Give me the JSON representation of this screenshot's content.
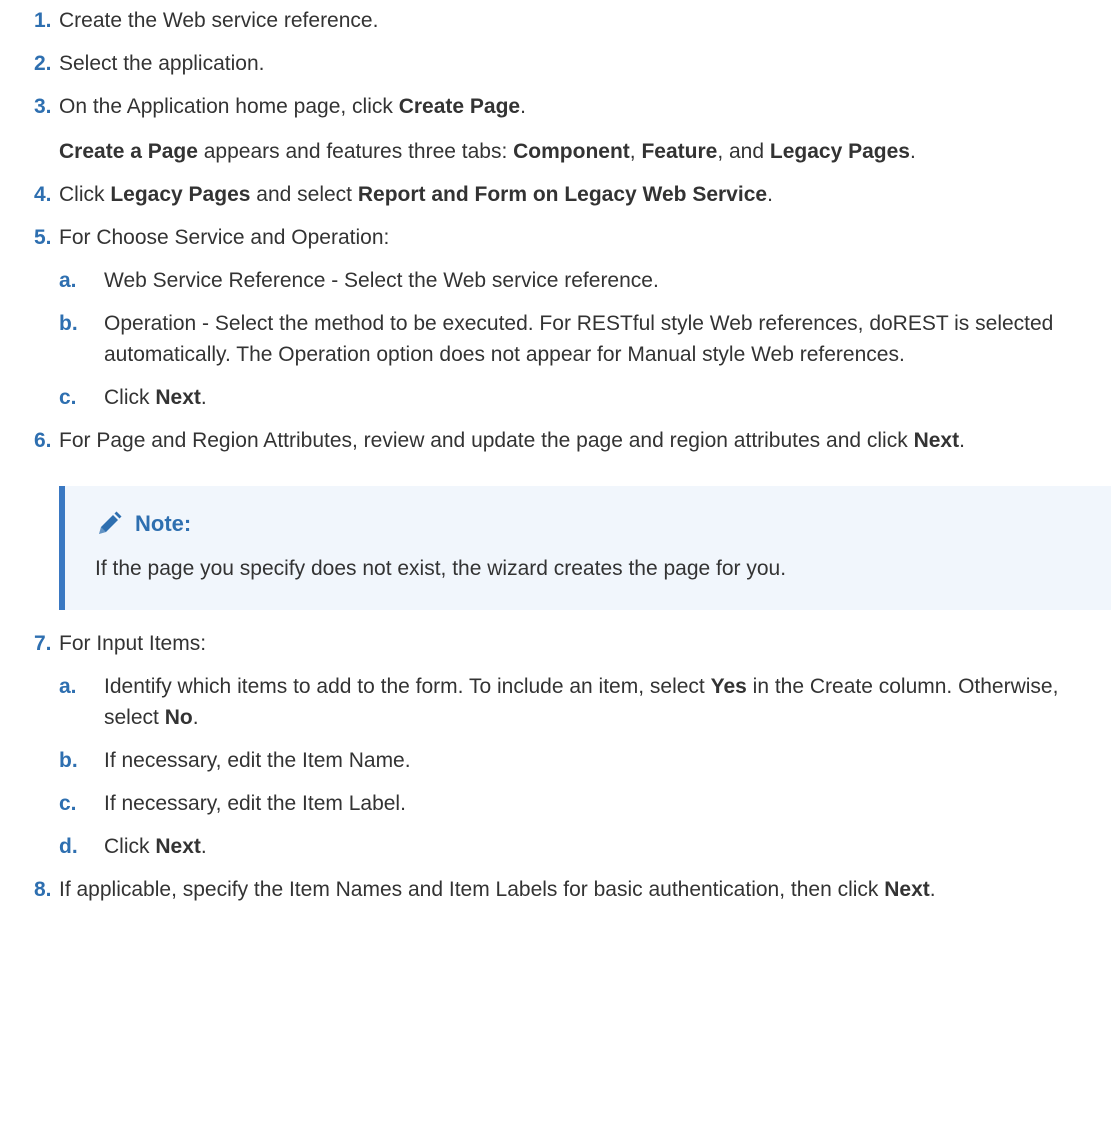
{
  "steps": [
    {
      "num": "1.",
      "text": "Create the Web service reference."
    },
    {
      "num": "2.",
      "text": "Select the application."
    },
    {
      "num": "3.",
      "pre": "On the Application home page, click ",
      "bold": "Create Page",
      "post": ".",
      "para2": {
        "b1": "Create a Page",
        "t1": " appears and features three tabs: ",
        "b2": "Component",
        "t2": ", ",
        "b3": "Feature",
        "t3": ", and ",
        "b4": "Legacy Pages",
        "t4": "."
      }
    },
    {
      "num": "4.",
      "pre": "Click ",
      "b1": "Legacy Pages",
      "mid": " and select ",
      "b2": "Report and Form on Legacy Web Service",
      "post": "."
    },
    {
      "num": "5.",
      "text": "For Choose Service and Operation:",
      "subs": [
        {
          "letter": "a.",
          "text": "Web Service Reference - Select the Web service reference."
        },
        {
          "letter": "b.",
          "text": "Operation - Select the method to be executed. For RESTful style Web references, doREST is selected automatically. The Operation option does not appear for Manual style Web references."
        },
        {
          "letter": "c.",
          "pre": "Click ",
          "bold": "Next",
          "post": "."
        }
      ]
    },
    {
      "num": "6.",
      "pre": "For Page and Region Attributes, review and update the page and region attributes and click ",
      "bold": "Next",
      "post": "."
    },
    {
      "num": "7.",
      "text": "For Input Items:",
      "subs": [
        {
          "letter": "a.",
          "pre": "Identify which items to add to the form. To include an item, select ",
          "b1": "Yes",
          "mid": " in the Create column. Otherwise, select ",
          "b2": "No",
          "post": "."
        },
        {
          "letter": "b.",
          "text": "If necessary, edit the Item Name."
        },
        {
          "letter": "c.",
          "text": "If necessary, edit the Item Label."
        },
        {
          "letter": "d.",
          "pre": "Click ",
          "bold": "Next",
          "post": "."
        }
      ]
    },
    {
      "num": "8.",
      "pre": "If applicable, specify the Item Names and Item Labels for basic authentication, then click ",
      "bold": "Next",
      "post": "."
    }
  ],
  "note": {
    "title": "Note:",
    "icon": "pencil-icon",
    "text": "If the page you specify does not exist, the wizard creates the page for you."
  },
  "colors": {
    "accent": "#2e6fb0",
    "note_bg": "#f1f6fc",
    "note_border": "#3a78c2",
    "text": "#333333"
  }
}
